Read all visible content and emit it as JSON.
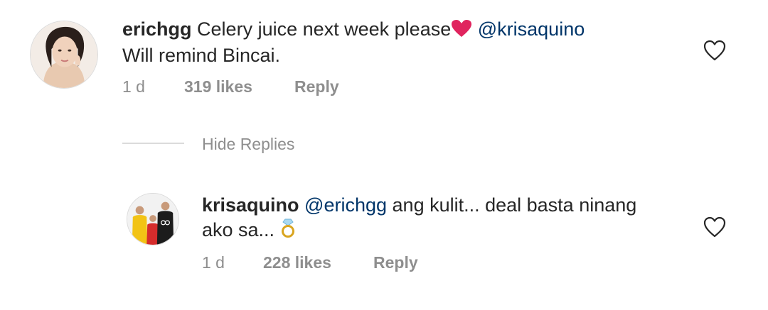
{
  "comments": [
    {
      "username": "erichgg",
      "text_before": "Celery juice next week please",
      "emoji": "heart-emoji",
      "mention": "@krisaquino",
      "text_line2": "Will remind Bincai.",
      "time": "1 d",
      "likes": "319 likes",
      "reply": "Reply",
      "avatar_icon": "profile-photo"
    }
  ],
  "hide_replies": {
    "label": "Hide Replies"
  },
  "replies": [
    {
      "username": "krisaquino",
      "mention": "@erichgg",
      "text_after": "ang kulit... deal basta ninang",
      "text_line2": "ako sa...",
      "emoji": "ring-emoji",
      "time": "1 d",
      "likes": "228 likes",
      "reply": "Reply",
      "avatar_icon": "profile-photo"
    }
  ],
  "colors": {
    "text": "#262626",
    "mention": "#003569",
    "muted": "#8e8e8e",
    "divider": "#dbdbdb",
    "emoji_heart": "#e0245e"
  }
}
